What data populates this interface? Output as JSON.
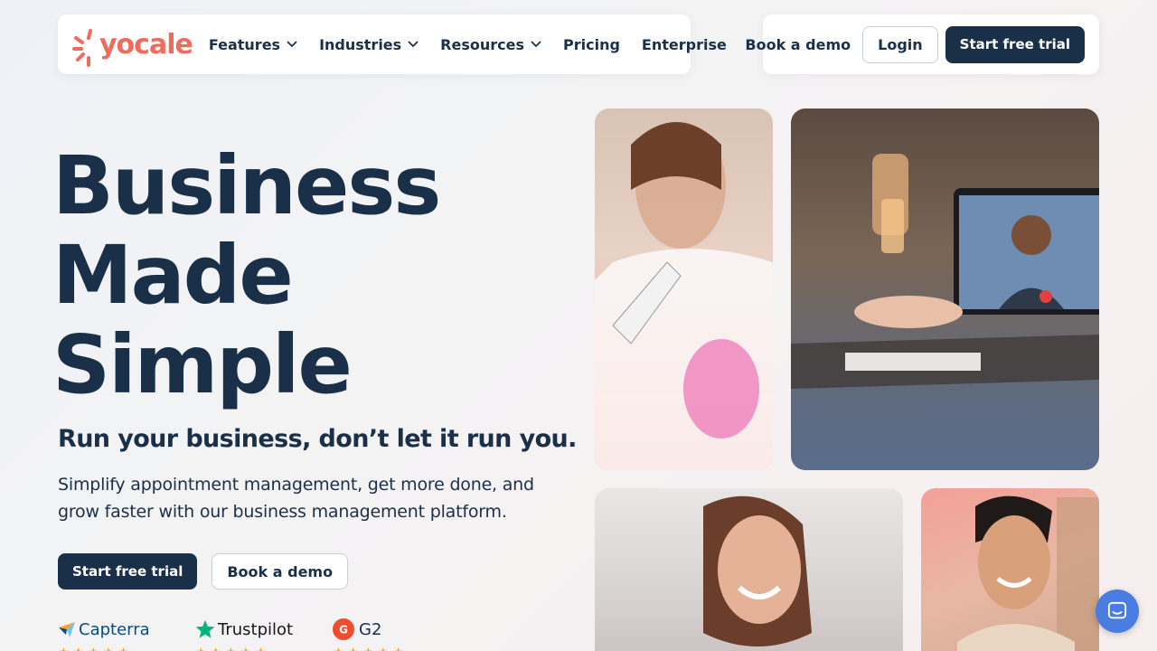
{
  "brand": {
    "name": "yocale",
    "color": "#ef6b5c"
  },
  "nav": {
    "items": [
      {
        "label": "Features",
        "dropdown": true
      },
      {
        "label": "Industries",
        "dropdown": true
      },
      {
        "label": "Resources",
        "dropdown": true
      },
      {
        "label": "Pricing",
        "dropdown": false
      },
      {
        "label": "Enterprise",
        "dropdown": false
      }
    ],
    "book_demo": "Book a demo",
    "login": "Login",
    "start_trial": "Start free trial"
  },
  "hero": {
    "title_lines": [
      "Business",
      "Made",
      "Simple"
    ],
    "subhead": "Run your business, don’t let it run you.",
    "paragraph": "Simplify appointment management, get more done, and grow faster with our business management platform.",
    "cta_primary": "Start free trial",
    "cta_secondary": "Book a demo"
  },
  "ratings": [
    {
      "name": "Capterra",
      "icon": "capterra-icon"
    },
    {
      "name": "Trustpilot",
      "icon": "trustpilot-star-icon"
    },
    {
      "name": "G2",
      "icon": "g2-icon"
    }
  ],
  "colors": {
    "primary": "#1a3049",
    "accent": "#ef6b5c",
    "chat": "#4a7de2",
    "star": "#f5a623"
  }
}
